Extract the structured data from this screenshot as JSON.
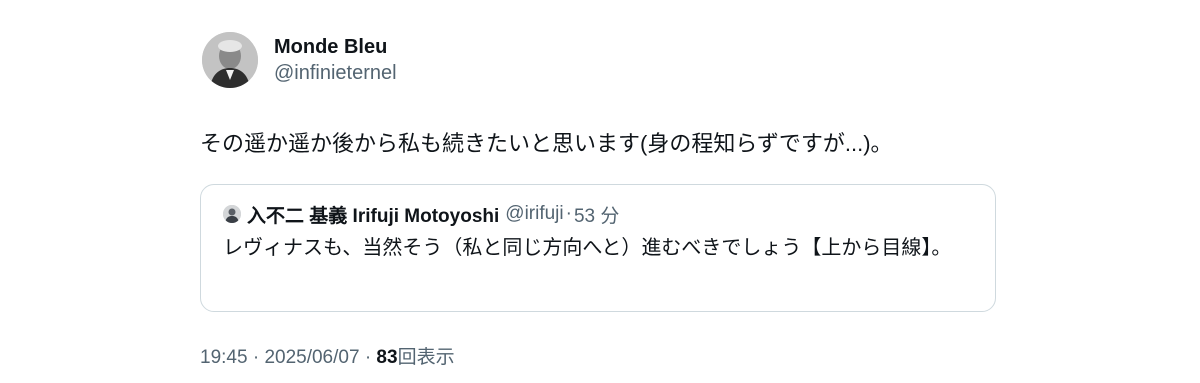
{
  "author": {
    "display_name": "Monde Bleu",
    "handle": "@infinieternel",
    "avatar_icon": "profile-photo-icon"
  },
  "post": {
    "text": "その遥か遥か後から私も続きたいと思います(身の程知らずですが...)。"
  },
  "quoted_post": {
    "author_name": "入不二 基義 Irifuji Motoyoshi",
    "author_handle": "@irifuji",
    "separator": "·",
    "time_ago": "53 分",
    "text": "レヴィナスも、当然そう（私と同じ方向へと）進むべきでしょう【上から目線】。",
    "avatar_icon": "profile-photo-icon"
  },
  "meta": {
    "time": "19:45",
    "separator1": "·",
    "date": "2025/06/07",
    "separator2": "·",
    "views_count": "83",
    "views_label": "回表示"
  },
  "colors": {
    "text_primary": "#0f1419",
    "text_secondary": "#536471",
    "border": "#cfd9de",
    "background": "#ffffff"
  }
}
